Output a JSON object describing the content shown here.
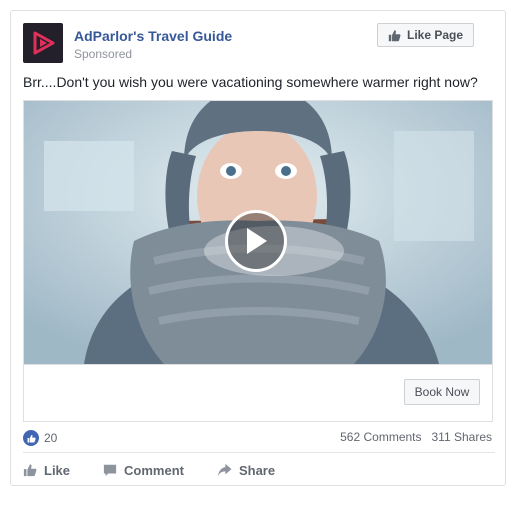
{
  "post": {
    "page_name": "AdParlor's Travel Guide",
    "sponsored_label": "Sponsored",
    "like_page_label": "Like Page",
    "text": "Brr....Don't you wish you were vacationing somewhere warmer right now?"
  },
  "cta": {
    "label": "Book Now"
  },
  "reactions": {
    "count": "20"
  },
  "stats": {
    "comments": "562 Comments",
    "shares": "311 Shares"
  },
  "actions": {
    "like": "Like",
    "comment": "Comment",
    "share": "Share"
  },
  "colors": {
    "link_blue": "#365899",
    "like_blue": "#4267b2",
    "brand_red": "#e0305a",
    "muted_text": "#616770"
  },
  "icons": [
    "adparlor-logo-icon",
    "thumbs-up-icon",
    "play-icon",
    "like-reaction-icon",
    "comment-icon",
    "share-icon"
  ]
}
